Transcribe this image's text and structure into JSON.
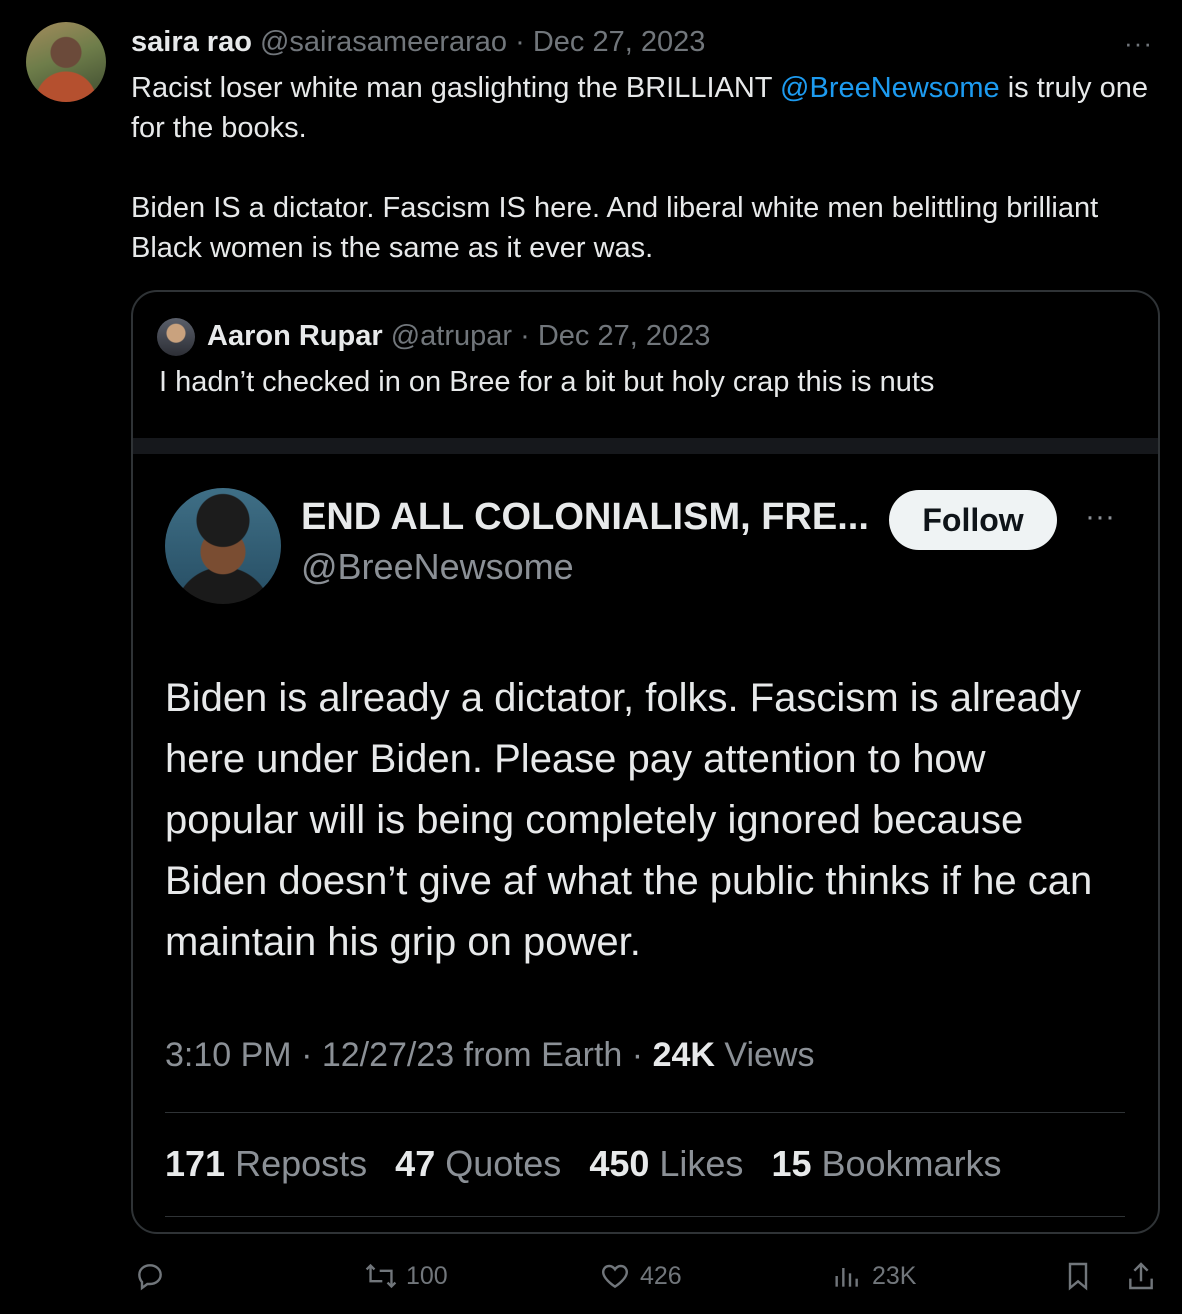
{
  "tweet": {
    "author_name": "saira rao",
    "author_handle": "@sairasameerarao",
    "separator": "·",
    "date": "Dec 27, 2023",
    "more_label": "···",
    "text_line1_before": "Racist loser white man gaslighting the BRILLIANT ",
    "text_mention": "@BreeNewsome",
    "text_line1_after": " is truly one for the books.",
    "text_para2": "Biden IS a dictator. Fascism IS here. And liberal white men belittling brilliant Black women is the same as it ever was."
  },
  "quote": {
    "author_name": "Aaron Rupar",
    "author_handle": "@atrupar",
    "separator": "·",
    "date": "Dec 27, 2023",
    "text": "I hadn’t checked in on Bree for a bit but holy crap this is nuts"
  },
  "embedded": {
    "name": "END ALL COLONIALISM, FRE...",
    "handle": "@BreeNewsome",
    "follow_label": "Follow",
    "more_label": "···",
    "body": "Biden is already a dictator, folks. Fascism is already here under Biden. Please pay attention to how popular will is being completely ignored because Biden doesn’t give af what the public thinks if he can maintain his grip on power.",
    "time": "3:10 PM · 12/27/23 from Earth · ",
    "views_count": "24K",
    "views_label": " Views",
    "stats": [
      {
        "count": "171",
        "label": " Reposts"
      },
      {
        "count": "47",
        "label": " Quotes"
      },
      {
        "count": "450",
        "label": " Likes"
      },
      {
        "count": "15",
        "label": " Bookmarks"
      }
    ]
  },
  "actions": {
    "reposts": "100",
    "likes": "426",
    "views": "23K"
  },
  "colors": {
    "background": "#000000",
    "text": "#e7e9ea",
    "muted": "#71767b",
    "link": "#1d9bf0",
    "border": "#2f3336"
  },
  "icons": [
    "reply-icon",
    "repost-icon",
    "like-icon",
    "views-icon",
    "bookmark-icon",
    "share-icon"
  ]
}
